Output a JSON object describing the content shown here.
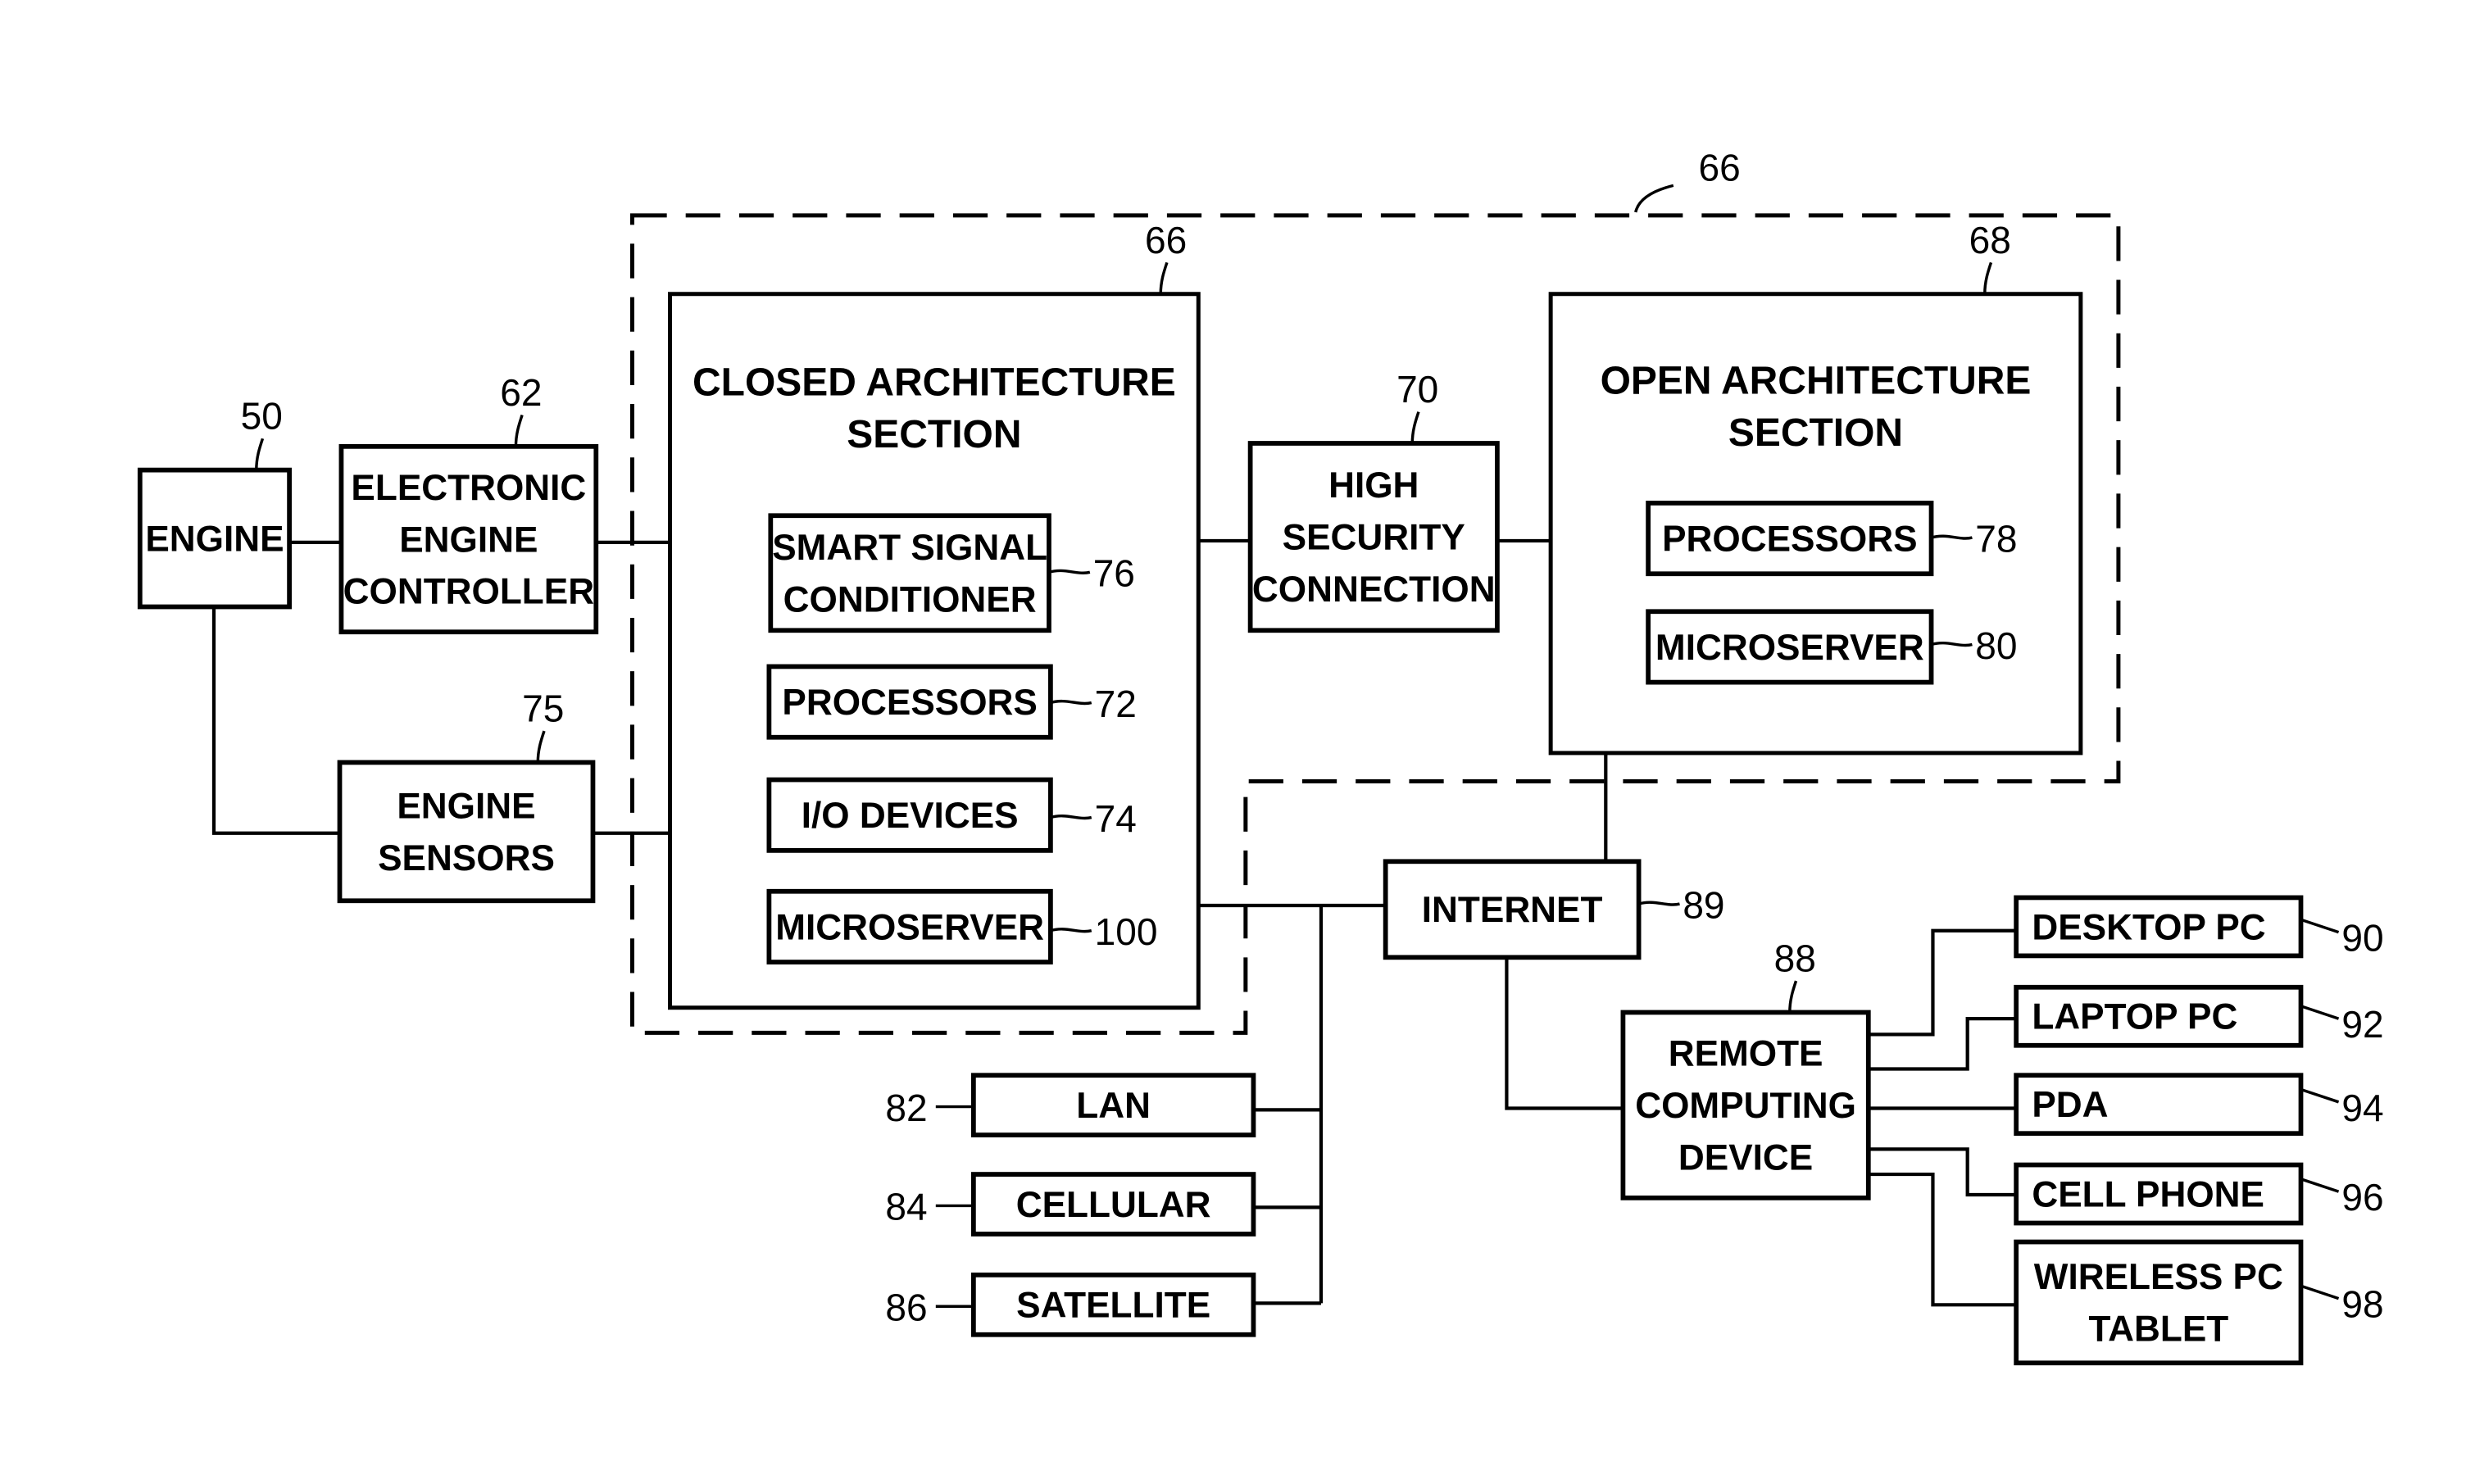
{
  "figure": {
    "boundary_ref": "66",
    "engine": {
      "label": [
        "ENGINE"
      ],
      "ref": "50"
    },
    "eec": {
      "label": [
        "ELECTRONIC",
        "ENGINE",
        "CONTROLLER"
      ],
      "ref": "62"
    },
    "sensors": {
      "label": [
        "ENGINE",
        "SENSORS"
      ],
      "ref": "75"
    },
    "closed_section": {
      "title": [
        "CLOSED ARCHITECTURE",
        "SECTION"
      ],
      "ref": "66",
      "items": [
        {
          "label": [
            "SMART SIGNAL",
            "CONDITIONER"
          ],
          "ref": "76"
        },
        {
          "label": [
            "PROCESSORS"
          ],
          "ref": "72"
        },
        {
          "label": [
            "I/O DEVICES"
          ],
          "ref": "74"
        },
        {
          "label": [
            "MICROSERVER"
          ],
          "ref": "100"
        }
      ]
    },
    "high_security": {
      "label": [
        "HIGH",
        "SECURITY",
        "CONNECTION"
      ],
      "ref": "70"
    },
    "open_section": {
      "title": [
        "OPEN ARCHITECTURE",
        "SECTION"
      ],
      "ref": "68",
      "items": [
        {
          "label": [
            "PROCESSORS"
          ],
          "ref": "78"
        },
        {
          "label": [
            "MICROSERVER"
          ],
          "ref": "80"
        }
      ]
    },
    "internet": {
      "label": [
        "INTERNET"
      ],
      "ref": "89"
    },
    "networks": [
      {
        "label": [
          "LAN"
        ],
        "ref": "82"
      },
      {
        "label": [
          "CELLULAR"
        ],
        "ref": "84"
      },
      {
        "label": [
          "SATELLITE"
        ],
        "ref": "86"
      }
    ],
    "remote": {
      "label": [
        "REMOTE",
        "COMPUTING",
        "DEVICE"
      ],
      "ref": "88"
    },
    "devices": [
      {
        "label": [
          "DESKTOP PC"
        ],
        "ref": "90"
      },
      {
        "label": [
          "LAPTOP PC"
        ],
        "ref": "92"
      },
      {
        "label": [
          "PDA"
        ],
        "ref": "94"
      },
      {
        "label": [
          "CELL PHONE"
        ],
        "ref": "96"
      },
      {
        "label": [
          "WIRELESS PC",
          "TABLET"
        ],
        "ref": "98"
      }
    ]
  }
}
